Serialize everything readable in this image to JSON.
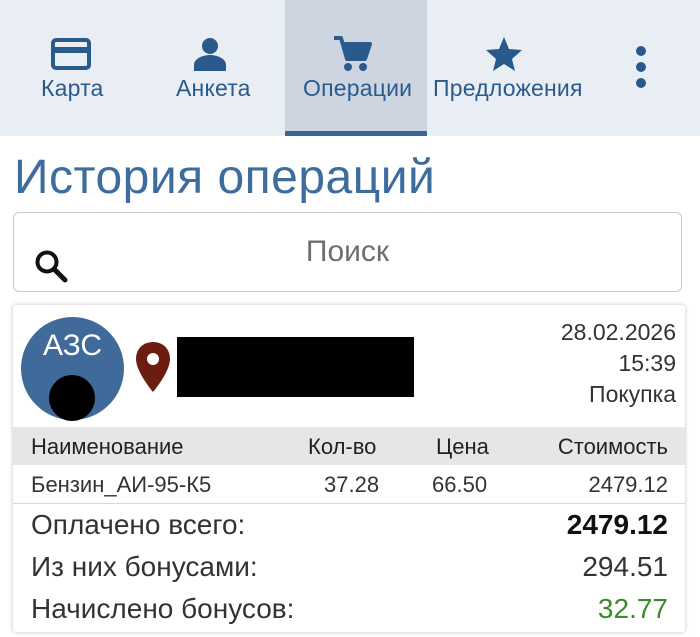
{
  "nav": {
    "tabs": [
      {
        "label": "Карта",
        "icon": "card-icon"
      },
      {
        "label": "Анкета",
        "icon": "person-icon"
      },
      {
        "label": "Операции",
        "icon": "cart-icon",
        "active": true
      },
      {
        "label": "Предложения",
        "icon": "star-icon"
      }
    ],
    "more_icon": "more-vertical-icon"
  },
  "page": {
    "title": "История операций"
  },
  "search": {
    "placeholder": "Поиск"
  },
  "operation": {
    "avatar_text": "АЗС",
    "date": "28.02.2026",
    "time": "15:39",
    "type": "Покупка",
    "table": {
      "headers": [
        "Наименование",
        "Кол-во",
        "Цена",
        "Стоимость"
      ],
      "rows": [
        [
          "Бензин_АИ-95-К5",
          "37.28",
          "66.50",
          "2479.12"
        ]
      ]
    },
    "summary": {
      "paid_total_label": "Оплачено всего:",
      "paid_total_value": "2479.12",
      "bonus_paid_label": "Из них бонусами:",
      "bonus_paid_value": "294.51",
      "bonus_earned_label": "Начислено бонусов:",
      "bonus_earned_value": "32.77"
    }
  },
  "colors": {
    "accent": "#3d6d9f",
    "nav_bg": "#e9eef5",
    "active_tab_bg": "#cdd6e0",
    "bonus_green": "#3a8b2a",
    "pin": "#6b1d12"
  }
}
